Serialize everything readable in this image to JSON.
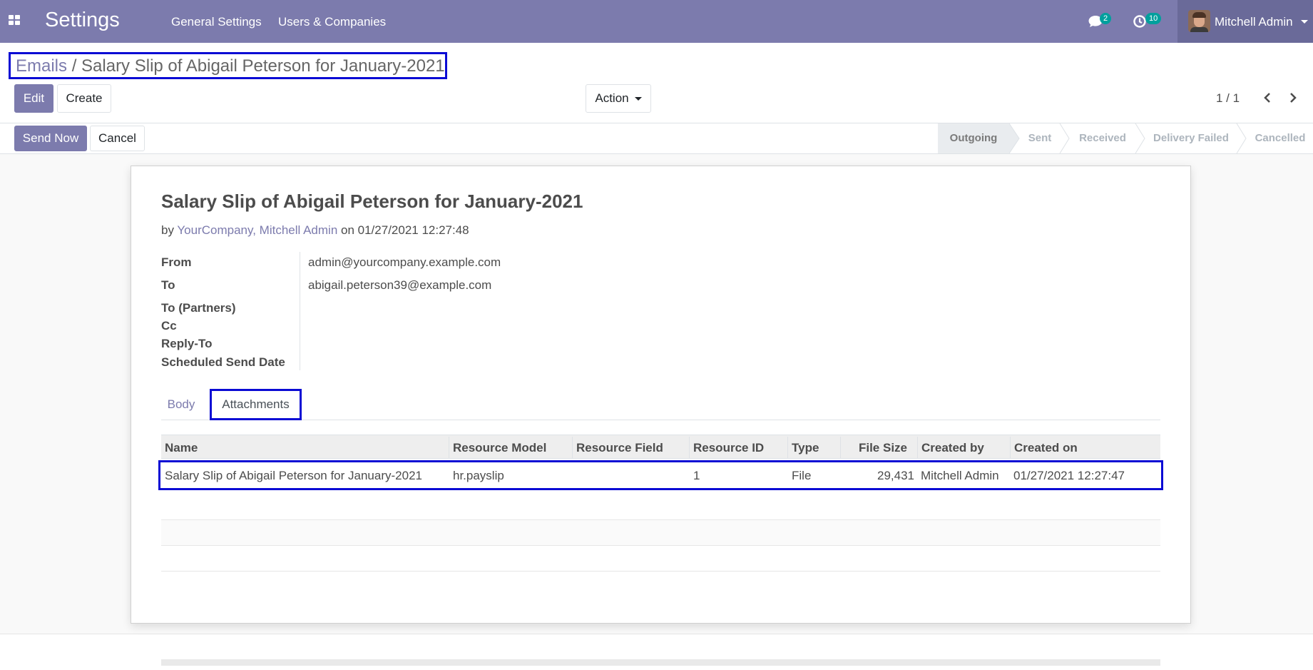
{
  "navbar": {
    "app_title": "Settings",
    "menu": [
      "General Settings",
      "Users & Companies"
    ],
    "messages_count": "2",
    "activities_count": "10",
    "user_name": "Mitchell Admin"
  },
  "breadcrumb": {
    "parent": "Emails",
    "separator": "/",
    "current": "Salary Slip of Abigail Peterson for January-2021"
  },
  "control_panel": {
    "edit_label": "Edit",
    "create_label": "Create",
    "action_label": "Action",
    "pager": "1 / 1"
  },
  "statusbar": {
    "send_now_label": "Send Now",
    "cancel_label": "Cancel",
    "stages": [
      "Outgoing",
      "Sent",
      "Received",
      "Delivery Failed",
      "Cancelled"
    ],
    "active_stage": "Outgoing"
  },
  "mail": {
    "subject": "Salary Slip of Abigail Peterson for January-2021",
    "by_prefix": "by",
    "author": "YourCompany, Mitchell Admin",
    "on_text": "on 01/27/2021 12:27:48",
    "fields": [
      {
        "label": "From",
        "value": "admin@yourcompany.example.com"
      },
      {
        "label": "To",
        "value": "abigail.peterson39@example.com"
      },
      {
        "label": "To (Partners)",
        "value": ""
      },
      {
        "label": "Cc",
        "value": ""
      },
      {
        "label": "Reply-To",
        "value": ""
      },
      {
        "label": "Scheduled Send Date",
        "value": ""
      }
    ]
  },
  "tabs": [
    "Body",
    "Attachments"
  ],
  "attachments": {
    "columns": [
      "Name",
      "Resource Model",
      "Resource Field",
      "Resource ID",
      "Type",
      "File Size",
      "Created by",
      "Created on"
    ],
    "rows": [
      {
        "name": "Salary Slip of Abigail Peterson for January-2021",
        "res_model": "hr.payslip",
        "res_field": "",
        "res_id": "1",
        "type": "File",
        "file_size": "29,431",
        "created_by": "Mitchell Admin",
        "created_on": "01/27/2021 12:27:47"
      }
    ]
  },
  "colors": {
    "brand": "#7c7bad",
    "highlight": "#0b0bd4",
    "badge": "#00a09d"
  }
}
